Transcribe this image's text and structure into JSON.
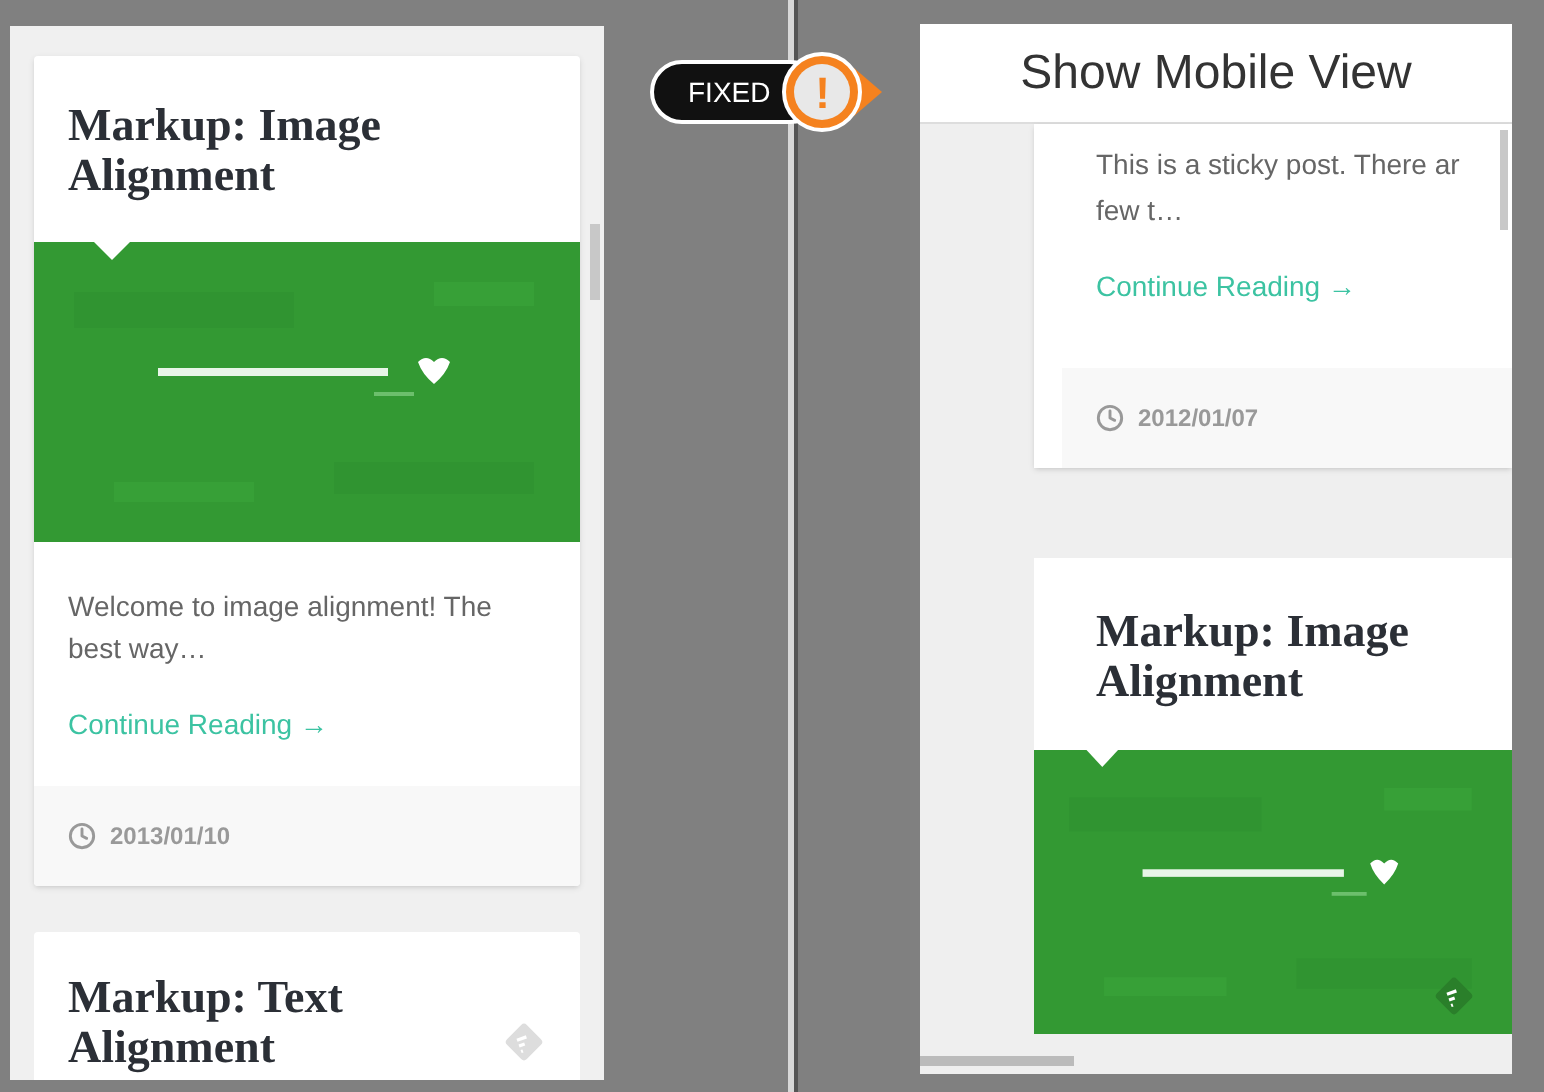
{
  "fixed_badge": {
    "label": "FIXED",
    "icon_text": "!"
  },
  "left_view": {
    "posts": [
      {
        "title": "Markup: Image Alignment",
        "excerpt": "Welcome to image alignment! The best way…",
        "link": "Continue Reading →",
        "date": "2013/01/10"
      },
      {
        "title": "Markup: Text Alignment",
        "format_icon": true
      }
    ]
  },
  "right_view": {
    "header": "Show Mobile View",
    "posts": [
      {
        "excerpt_lines": [
          "This is a sticky post. There ar",
          "few t…"
        ],
        "link": "Continue Reading →",
        "date": "2012/01/07"
      },
      {
        "title": "Markup: Image Alignment",
        "format_icon": true
      }
    ]
  }
}
